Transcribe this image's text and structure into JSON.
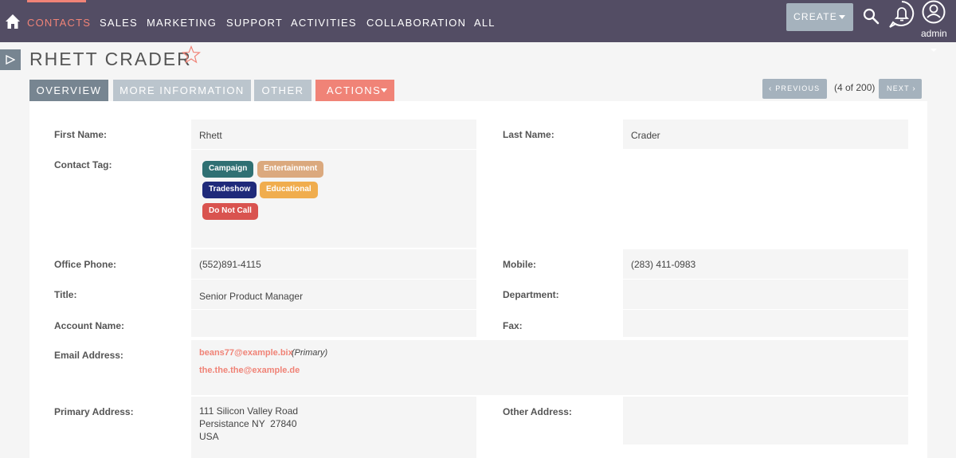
{
  "nav": {
    "items": [
      "CONTACTS",
      "SALES",
      "MARKETING",
      "SUPPORT",
      "ACTIVITIES",
      "COLLABORATION",
      "ALL"
    ],
    "create_label": "CREATE",
    "user_label": "admin"
  },
  "record": {
    "title": "RHETT CRADER"
  },
  "tabs": {
    "overview": "OVERVIEW",
    "more_information": "MORE INFORMATION",
    "other": "OTHER",
    "actions": "ACTIONS"
  },
  "pager": {
    "previous": "PREVIOUS",
    "count": "(4 of 200)",
    "next": "NEXT"
  },
  "fields": {
    "first_name": {
      "label": "First Name:",
      "value": "Rhett"
    },
    "last_name": {
      "label": "Last Name:",
      "value": "Crader"
    },
    "contact_tag": {
      "label": "Contact Tag:"
    },
    "office_phone": {
      "label": "Office Phone:",
      "value": "(552)891-4115"
    },
    "mobile": {
      "label": "Mobile:",
      "value": "(283) 411-0983"
    },
    "title": {
      "label": "Title:",
      "value": "Senior Product Manager"
    },
    "department": {
      "label": "Department:",
      "value": ""
    },
    "account_name": {
      "label": "Account Name:",
      "value": ""
    },
    "fax": {
      "label": "Fax:",
      "value": ""
    },
    "email": {
      "label": "Email Address:",
      "primary": "beans77@example.bix",
      "primary_note": "(Primary)",
      "secondary": "the.the.the@example.de"
    },
    "primary_address": {
      "label": "Primary Address:",
      "line1": "111 Silicon Valley Road",
      "line2": "Persistance NY  27840",
      "line3": "USA"
    },
    "other_address": {
      "label": "Other Address:",
      "value": ""
    }
  },
  "tags": [
    {
      "label": "Campaign",
      "color": "#2f7073"
    },
    {
      "label": "Entertainment",
      "color": "#dba97e"
    },
    {
      "label": "Tradeshow",
      "color": "#1f2a7a"
    },
    {
      "label": "Educational",
      "color": "#f0ad4e"
    },
    {
      "label": "Do Not Call",
      "color": "#d9534f"
    }
  ],
  "colors": {
    "nav_bg": "#534d64",
    "accent": "#f08377",
    "tab_active": "#778591",
    "tab_inactive": "#bbc5cd"
  }
}
